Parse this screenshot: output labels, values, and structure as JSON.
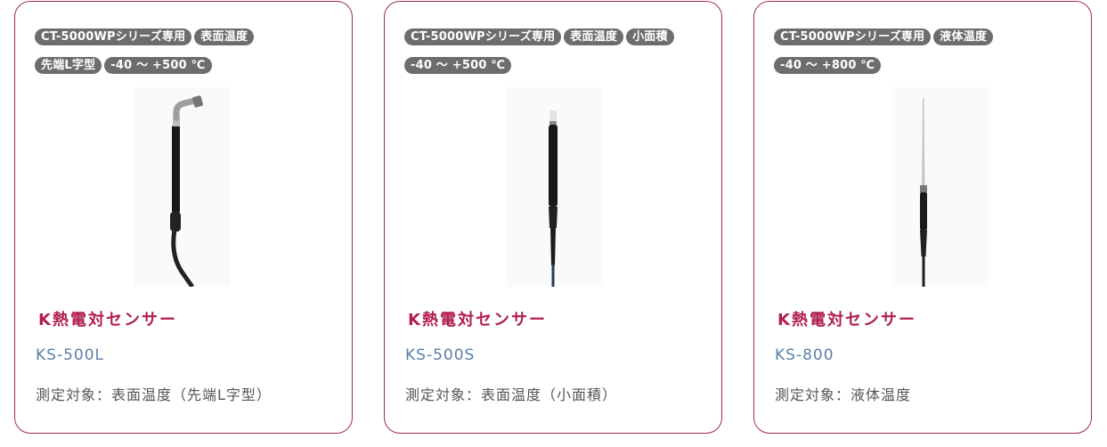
{
  "cards": [
    {
      "tags": [
        "CT-5000WPシリーズ専用",
        "表面温度",
        "先端L字型",
        "-40 〜 +500 ℃"
      ],
      "title": "K熱電対センサー",
      "model": "KS-500L",
      "description": "測定対象：表面温度（先端L字型）",
      "image": "ks-500l-probe"
    },
    {
      "tags": [
        "CT-5000WPシリーズ専用",
        "表面温度",
        "小面積",
        "-40 〜 +500 ℃"
      ],
      "title": "K熱電対センサー",
      "model": "KS-500S",
      "description": "測定対象：表面温度（小面積）",
      "image": "ks-500s-probe"
    },
    {
      "tags": [
        "CT-5000WPシリーズ専用",
        "液体温度",
        "-40 〜 +800 ℃"
      ],
      "title": "K熱電対センサー",
      "model": "KS-800",
      "description": "測定対象：液体温度",
      "image": "ks-800-probe"
    }
  ],
  "colors": {
    "accent": "#b01f4e",
    "border": "#a1285a",
    "tag_bg": "#6d6d6d",
    "model_text": "#5a7ea8"
  }
}
